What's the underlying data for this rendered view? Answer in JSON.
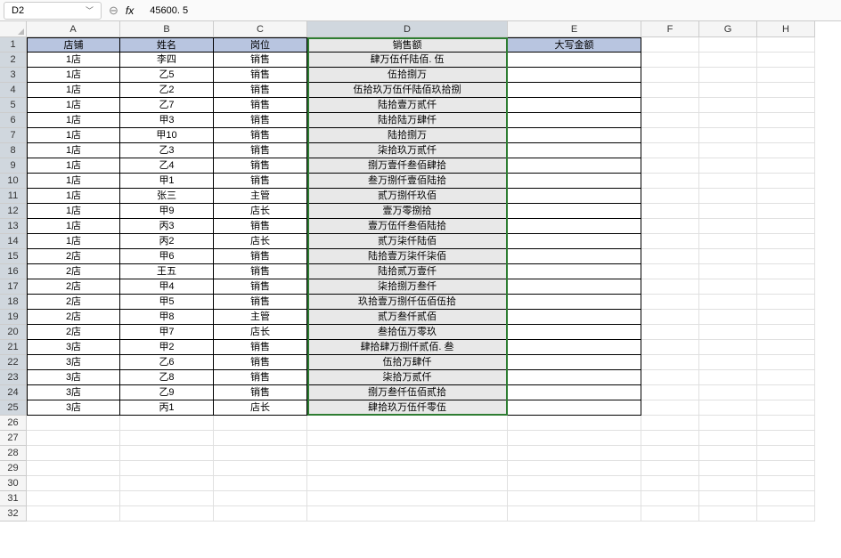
{
  "toolbar": {
    "namebox_value": "D2",
    "fx_cancel": "⊖",
    "fx_label": "fx",
    "formula_value": "45600. 5"
  },
  "columns": [
    "A",
    "B",
    "C",
    "D",
    "E",
    "F",
    "G",
    "H"
  ],
  "selected_col": "D",
  "header_row": {
    "A": "店铺",
    "B": "姓名",
    "C": "岗位",
    "D": "销售额",
    "E": "大写金额"
  },
  "rows": [
    {
      "n": 2,
      "A": "1店",
      "B": "李四",
      "C": "销售",
      "D": "肆万伍仟陆佰. 伍",
      "E": ""
    },
    {
      "n": 3,
      "A": "1店",
      "B": "乙5",
      "C": "销售",
      "D": "伍拾捌万",
      "E": ""
    },
    {
      "n": 4,
      "A": "1店",
      "B": "乙2",
      "C": "销售",
      "D": "伍拾玖万伍仟陆佰玖拾捌",
      "E": ""
    },
    {
      "n": 5,
      "A": "1店",
      "B": "乙7",
      "C": "销售",
      "D": "陆拾壹万贰仟",
      "E": ""
    },
    {
      "n": 6,
      "A": "1店",
      "B": "甲3",
      "C": "销售",
      "D": "陆拾陆万肆仟",
      "E": ""
    },
    {
      "n": 7,
      "A": "1店",
      "B": "甲10",
      "C": "销售",
      "D": "陆拾捌万",
      "E": ""
    },
    {
      "n": 8,
      "A": "1店",
      "B": "乙3",
      "C": "销售",
      "D": "柒拾玖万贰仟",
      "E": ""
    },
    {
      "n": 9,
      "A": "1店",
      "B": "乙4",
      "C": "销售",
      "D": "捌万壹仟叁佰肆拾",
      "E": ""
    },
    {
      "n": 10,
      "A": "1店",
      "B": "甲1",
      "C": "销售",
      "D": "叁万捌仟壹佰陆拾",
      "E": ""
    },
    {
      "n": 11,
      "A": "1店",
      "B": "张三",
      "C": "主管",
      "D": "贰万捌仟玖佰",
      "E": ""
    },
    {
      "n": 12,
      "A": "1店",
      "B": "甲9",
      "C": "店长",
      "D": "壹万零捌拾",
      "E": ""
    },
    {
      "n": 13,
      "A": "1店",
      "B": "丙3",
      "C": "销售",
      "D": "壹万伍仟叁佰陆拾",
      "E": ""
    },
    {
      "n": 14,
      "A": "1店",
      "B": "丙2",
      "C": "店长",
      "D": "贰万柒仟陆佰",
      "E": ""
    },
    {
      "n": 15,
      "A": "2店",
      "B": "甲6",
      "C": "销售",
      "D": "陆拾壹万柒仟柒佰",
      "E": ""
    },
    {
      "n": 16,
      "A": "2店",
      "B": "王五",
      "C": "销售",
      "D": "陆拾贰万壹仟",
      "E": ""
    },
    {
      "n": 17,
      "A": "2店",
      "B": "甲4",
      "C": "销售",
      "D": "柒拾捌万叁仟",
      "E": ""
    },
    {
      "n": 18,
      "A": "2店",
      "B": "甲5",
      "C": "销售",
      "D": "玖拾壹万捌仟伍佰伍拾",
      "E": ""
    },
    {
      "n": 19,
      "A": "2店",
      "B": "甲8",
      "C": "主管",
      "D": "贰万叁仟贰佰",
      "E": ""
    },
    {
      "n": 20,
      "A": "2店",
      "B": "甲7",
      "C": "店长",
      "D": "叁拾伍万零玖",
      "E": ""
    },
    {
      "n": 21,
      "A": "3店",
      "B": "甲2",
      "C": "销售",
      "D": "肆拾肆万捌仟贰佰. 叁",
      "E": ""
    },
    {
      "n": 22,
      "A": "3店",
      "B": "乙6",
      "C": "销售",
      "D": "伍拾万肆仟",
      "E": ""
    },
    {
      "n": 23,
      "A": "3店",
      "B": "乙8",
      "C": "销售",
      "D": "柒拾万贰仟",
      "E": ""
    },
    {
      "n": 24,
      "A": "3店",
      "B": "乙9",
      "C": "销售",
      "D": "捌万叁仟伍佰贰拾",
      "E": ""
    },
    {
      "n": 25,
      "A": "3店",
      "B": "丙1",
      "C": "店长",
      "D": "肆拾玖万伍仟零伍",
      "E": ""
    }
  ],
  "empty_rows": [
    26,
    27,
    28,
    29,
    30,
    31,
    32
  ],
  "selection": {
    "range": "D1:D25",
    "active": "D2"
  }
}
